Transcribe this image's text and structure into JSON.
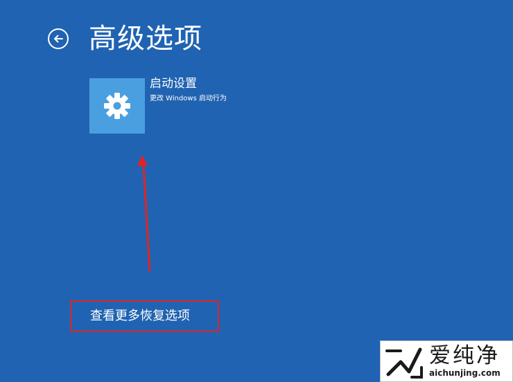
{
  "header": {
    "back_icon": "back-arrow-circle-icon",
    "title": "高级选项"
  },
  "options": [
    {
      "icon": "gear-icon",
      "title": "启动设置",
      "description": "更改 Windows 启动行为"
    }
  ],
  "footer": {
    "more_recovery_options": "查看更多恢复选项"
  },
  "watermark": {
    "name": "爱纯净",
    "url": "aichunjing.com"
  },
  "colors": {
    "background": "#2063b2",
    "tile": "#4a9fe0",
    "annotation": "#e02424",
    "text": "#ffffff"
  }
}
